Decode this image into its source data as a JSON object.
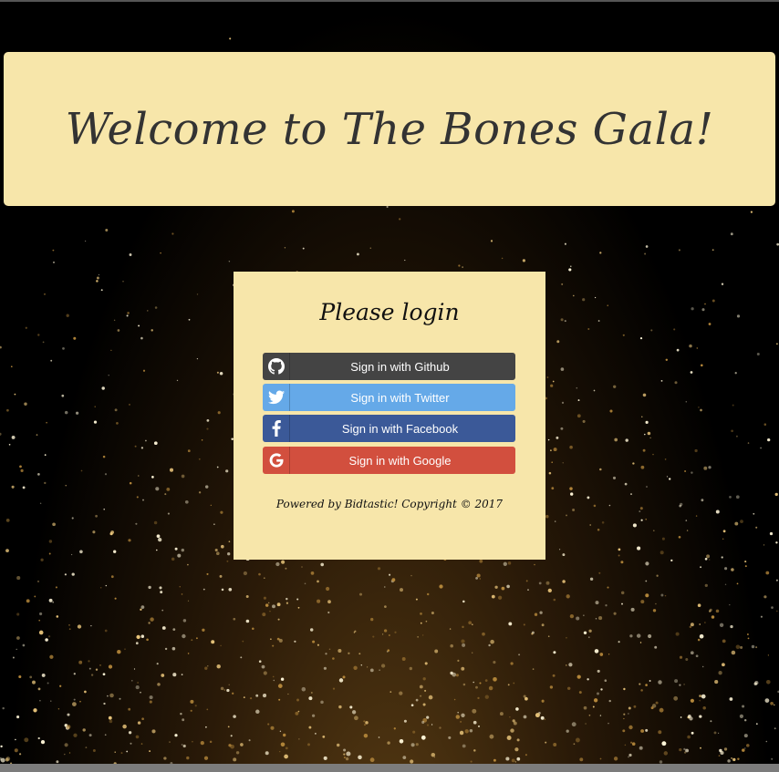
{
  "banner": {
    "title": "Welcome to The Bones Gala!"
  },
  "login": {
    "title": "Please login",
    "buttons": [
      {
        "label": "Sign in with Github",
        "icon": "github-icon",
        "color": "#444444"
      },
      {
        "label": "Sign in with Twitter",
        "icon": "twitter-icon",
        "color": "#65a9e8"
      },
      {
        "label": "Sign in with Facebook",
        "icon": "facebook-icon",
        "color": "#3b5998"
      },
      {
        "label": "Sign in with Google",
        "icon": "google-icon",
        "color": "#d24f3e"
      }
    ],
    "footer": "Powered by Bidtastic! Copyright © 2017"
  },
  "theme": {
    "panel_bg": "#f7e6aa",
    "page_bg": "#000000"
  }
}
